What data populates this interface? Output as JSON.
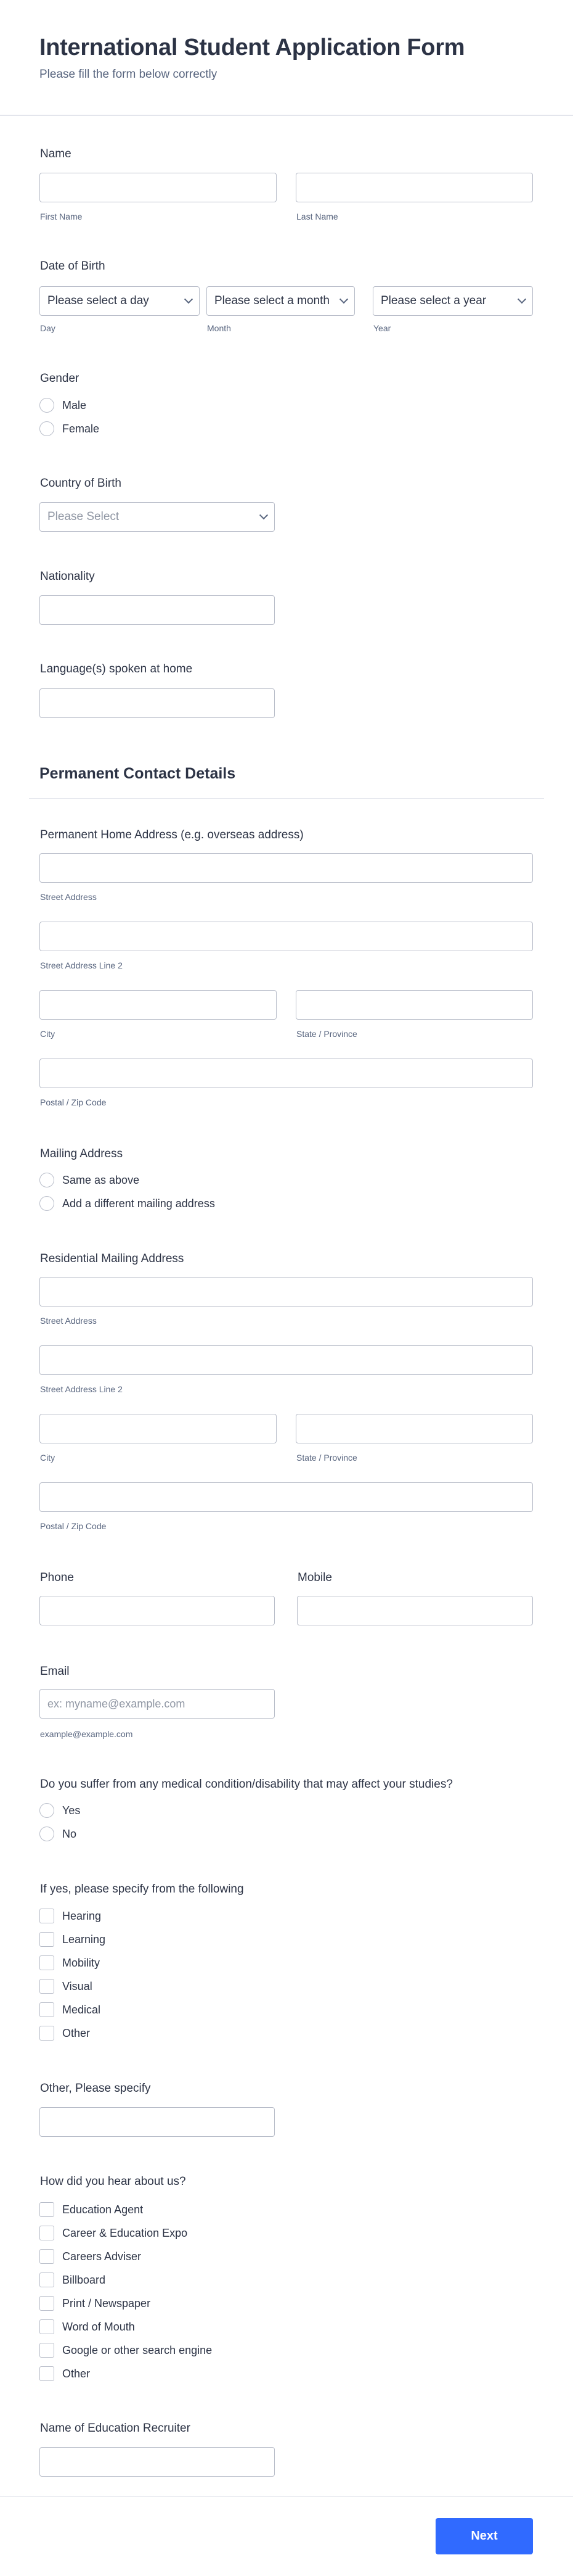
{
  "header": {
    "title": "International Student Application Form",
    "subtitle": "Please fill the form below correctly"
  },
  "name": {
    "label": "Name",
    "first": {
      "value": "",
      "sublabel": "First Name"
    },
    "last": {
      "value": "",
      "sublabel": "Last Name"
    }
  },
  "dob": {
    "label": "Date of Birth",
    "day": {
      "selected": "Please select a day",
      "sublabel": "Day"
    },
    "month": {
      "selected": "Please select a month",
      "sublabel": "Month"
    },
    "year": {
      "selected": "Please select a year",
      "sublabel": "Year"
    }
  },
  "gender": {
    "label": "Gender",
    "options": [
      "Male",
      "Female"
    ]
  },
  "country_of_birth": {
    "label": "Country of Birth",
    "selected": "Please Select"
  },
  "nationality": {
    "label": "Nationality",
    "value": ""
  },
  "languages": {
    "label": "Language(s) spoken at home",
    "value": ""
  },
  "section": {
    "title": "Permanent Contact Details"
  },
  "permanent_address": {
    "label": "Permanent Home Address (e.g. overseas address)",
    "street": "Street Address",
    "street2": "Street Address Line 2",
    "city": "City",
    "state": "State / Province",
    "postal": "Postal / Zip Code"
  },
  "mailing_address": {
    "label": "Mailing Address",
    "options": [
      "Same as above",
      "Add a different mailing address"
    ]
  },
  "residential_address": {
    "label": "Residential Mailing Address",
    "street": "Street Address",
    "street2": "Street Address Line 2",
    "city": "City",
    "state": "State / Province",
    "postal": "Postal / Zip Code"
  },
  "phone": {
    "label": "Phone",
    "value": ""
  },
  "mobile": {
    "label": "Mobile",
    "value": ""
  },
  "email": {
    "label": "Email",
    "placeholder": "ex: myname@example.com",
    "sublabel": "example@example.com"
  },
  "medical": {
    "label": "Do you suffer from any medical condition/disability that may affect your studies?",
    "options": [
      "Yes",
      "No"
    ]
  },
  "specify": {
    "label": "If yes, please specify from the following",
    "options": [
      "Hearing",
      "Learning",
      "Mobility",
      "Visual",
      "Medical",
      "Other"
    ]
  },
  "other_specify": {
    "label": "Other, Please specify",
    "value": ""
  },
  "hear_about": {
    "label": "How did you hear about us?",
    "options": [
      "Education Agent",
      "Career & Education Expo",
      "Careers Adviser",
      "Billboard",
      "Print / Newspaper",
      "Word of Mouth",
      "Google or other search engine",
      "Other"
    ]
  },
  "recruiter": {
    "label": "Name of Education Recruiter",
    "value": ""
  },
  "footer": {
    "next_label": "Next"
  },
  "colors": {
    "accent": "#306aff",
    "text": "#2c3345",
    "muted": "#57647e",
    "border": "#b8bdc9"
  }
}
